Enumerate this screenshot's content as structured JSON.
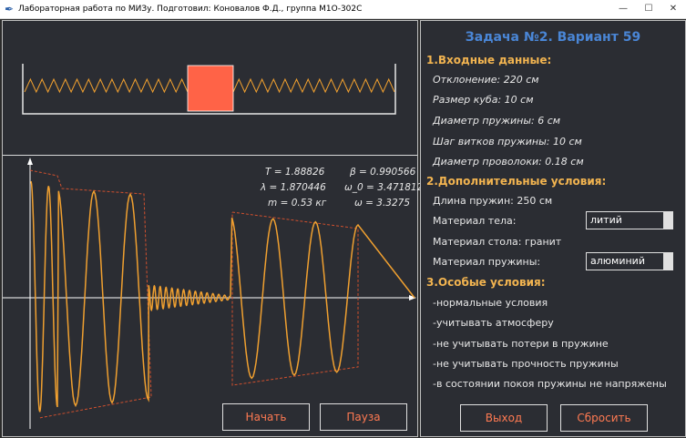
{
  "window": {
    "title": "Лабораторная работа по МИЗу. Подготовил: Коновалов Ф.Д., группа М1О-302С"
  },
  "params": {
    "T": "T = 1.88826",
    "beta": "β = 0.990566",
    "lambda": "λ = 1.870446",
    "omega0": "ω_0 = 3.471812",
    "m": "m = 0.53 кг",
    "omega": "ω = 3.3275"
  },
  "buttons": {
    "start": "Начать",
    "pause": "Пауза",
    "exit": "Выход",
    "reset": "Сбросить"
  },
  "task": {
    "title": "Задача №2. Вариант 59",
    "section1": "1.Входные данные:",
    "deviation": "Отклонение: 220 см",
    "cube_size": "Размер куба: 10 см",
    "spring_diameter": "Диаметр пружины: 6 см",
    "coil_pitch": "Шаг витков пружины: 10 см",
    "wire_diameter": "Диаметр проволоки: 0.18 см",
    "section2": "2.Дополнительные условия:",
    "spring_length": "Длина пружин: 250 см",
    "body_material_label": "Материал тела:",
    "body_material_value": "литий",
    "table_material": "Материал стола: гранит",
    "spring_material_label": "Материал пружины:",
    "spring_material_value": "алюминий",
    "section3": "3.Особые условия:",
    "cond1": "-нормальные условия",
    "cond2": "-учитывать атмосферу",
    "cond3": "-не учитывать потери в пружине",
    "cond4": "-не учитывать прочность пружины",
    "cond5": "-в состоянии покоя пружины не напряжены"
  },
  "colors": {
    "wave": "#f0a030",
    "envelope": "#d0502e",
    "cube": "#ff6347",
    "accent_text": "#ff7a52",
    "heading": "#f2b450",
    "title_blue": "#4a86d6"
  }
}
